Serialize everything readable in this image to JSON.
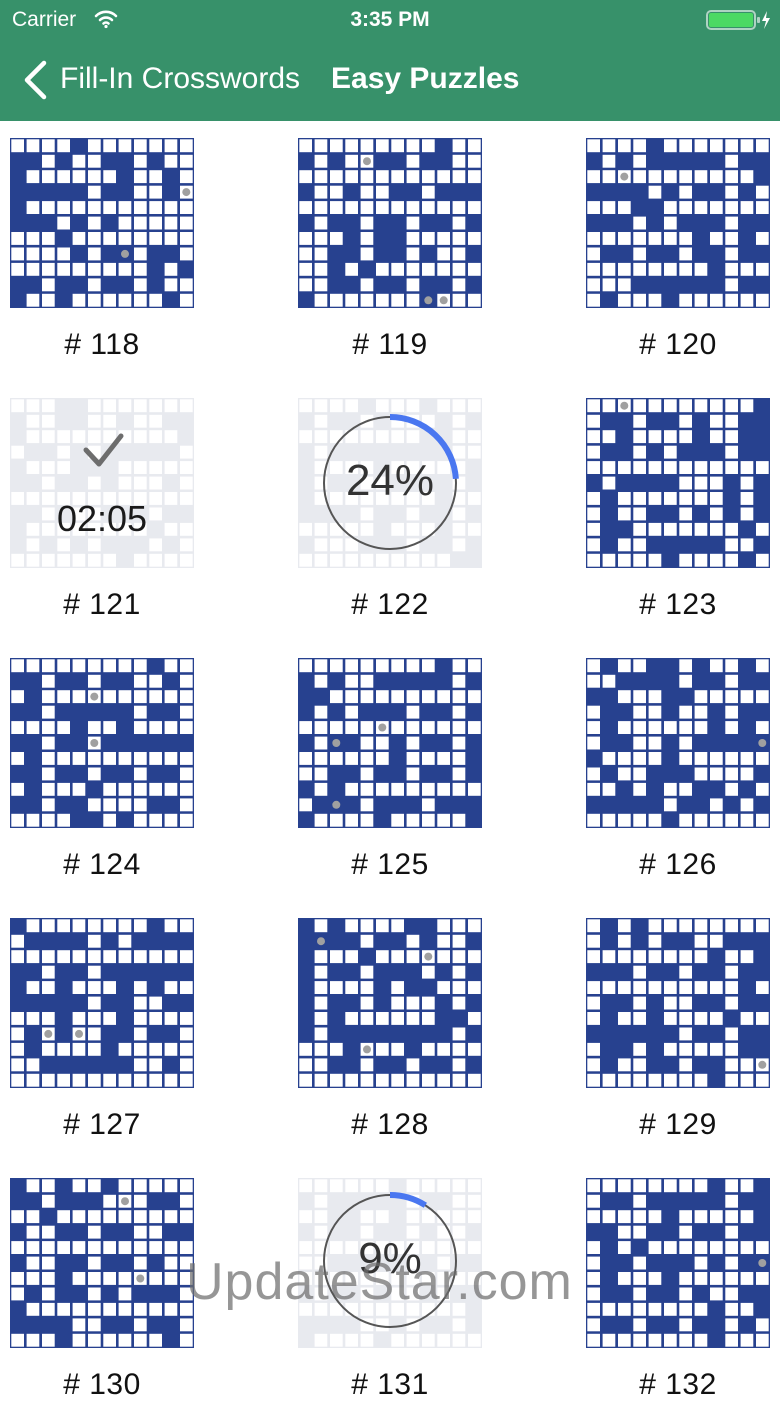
{
  "status_bar": {
    "carrier": "Carrier",
    "time": "3:35 PM",
    "battery_level": 1.0
  },
  "nav": {
    "back_label": "Fill-In Crosswords",
    "title": "Easy Puzzles"
  },
  "colors": {
    "header_green": "#37916a",
    "puzzle_blue": "#27418f",
    "cell_white": "#ffffff",
    "completed_grey": "#e8eaef",
    "progress_blue": "#4a77f0"
  },
  "icons": {
    "back": "chevron-left-icon",
    "wifi": "wifi-icon",
    "battery": "battery-icon",
    "done": "checkmark-icon"
  },
  "puzzles": [
    {
      "label": "# 118",
      "state": "new"
    },
    {
      "label": "# 119",
      "state": "new"
    },
    {
      "label": "# 120",
      "state": "new"
    },
    {
      "label": "# 121",
      "state": "completed",
      "time": "02:05"
    },
    {
      "label": "# 122",
      "state": "in-progress",
      "progress_text": "24%",
      "progress": 0.24
    },
    {
      "label": "# 123",
      "state": "new"
    },
    {
      "label": "# 124",
      "state": "new"
    },
    {
      "label": "# 125",
      "state": "new"
    },
    {
      "label": "# 126",
      "state": "new"
    },
    {
      "label": "# 127",
      "state": "new"
    },
    {
      "label": "# 128",
      "state": "new"
    },
    {
      "label": "# 129",
      "state": "new"
    },
    {
      "label": "# 130",
      "state": "new"
    },
    {
      "label": "# 131",
      "state": "in-progress",
      "progress_text": "9%",
      "progress": 0.09
    },
    {
      "label": "# 132",
      "state": "new"
    }
  ],
  "watermark": "UpdateStar.com"
}
